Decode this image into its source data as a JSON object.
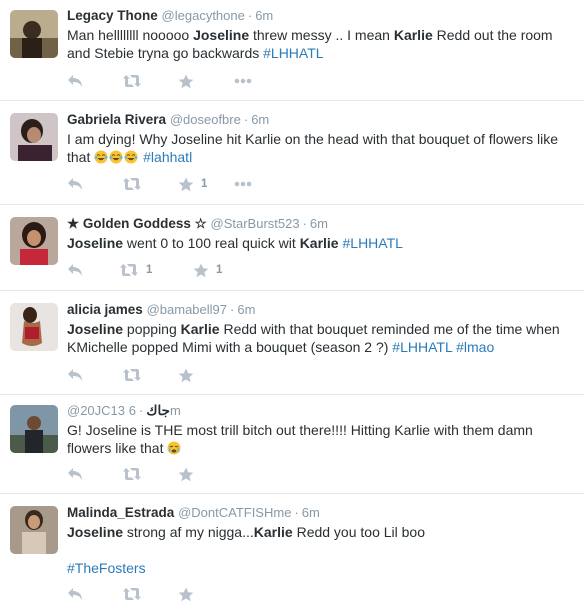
{
  "colors": {
    "link": "#2b7bb9",
    "meta": "#8899a6",
    "text": "#292f33",
    "divider": "#e1e8ed",
    "icon": "#b8c2cc"
  },
  "icons": {
    "reply": "reply-icon",
    "retweet": "retweet-icon",
    "favorite": "star-icon",
    "more": "more-icon",
    "emoji_laugh": "face-with-tears-of-joy-emoji",
    "emoji_cry": "crying-face-emoji"
  },
  "tweets": [
    {
      "fullname": "Legacy Thone",
      "handle": "@legacythone",
      "dot": "·",
      "time": "6m",
      "text": {
        "p1": "Man hellllllll nooooo ",
        "b1": "Joseline",
        "p2": " threw messy .. I mean ",
        "b2": "Karlie",
        "p3": " Redd out the room and Stebie tryna go backwards ",
        "tag1": "#LHHATL"
      }
    },
    {
      "fullname": "Gabriela Rivera",
      "handle": "@doseofbre",
      "dot": "·",
      "time": "6m",
      "text": {
        "p1": "I am dying! Why Joseline hit Karlie on the head with that bouquet of flowers like that ",
        "tag1": "#lahhatl"
      },
      "fav_count": "1"
    },
    {
      "fullname": "★ Golden Goddess ☆",
      "handle": "@StarBurst523",
      "dot": "·",
      "time": "6m",
      "text": {
        "b1": "Joseline",
        "p1": " went 0 to 100 real quick wit ",
        "b2": "Karlie",
        "p2": " ",
        "tag1": "#LHHATL"
      },
      "rt_count": "1",
      "fav_count": "1"
    },
    {
      "fullname": "alicia james",
      "handle": "@bamabell97",
      "dot": "·",
      "time": "6m",
      "text": {
        "b1": "Joseline",
        "p1": " popping ",
        "b2": "Karlie",
        "p2": " Redd with that bouquet reminded me of the time when KMichelle popped Mimi with a bouquet (season 2 ?) ",
        "tag1": "#LHHATL",
        "p3": " ",
        "tag2": "#lmao"
      }
    },
    {
      "fullname": "",
      "handle": "@20JC13",
      "name_suffix": "جاك",
      "dot": "·",
      "time": "6m",
      "text": {
        "p1": "G! Joseline is THE most trill bitch out there!!!! Hitting Karlie with them damn flowers like that "
      }
    },
    {
      "fullname": "Malinda_Estrada",
      "handle": "@DontCATFISHme",
      "dot": "·",
      "time": "6m",
      "text": {
        "b1": "Joseline",
        "p1": " strong af my nigga...",
        "b2": "Karlie",
        "p2": " Redd you too Lil boo",
        "tag1": "#TheFosters"
      }
    }
  ]
}
